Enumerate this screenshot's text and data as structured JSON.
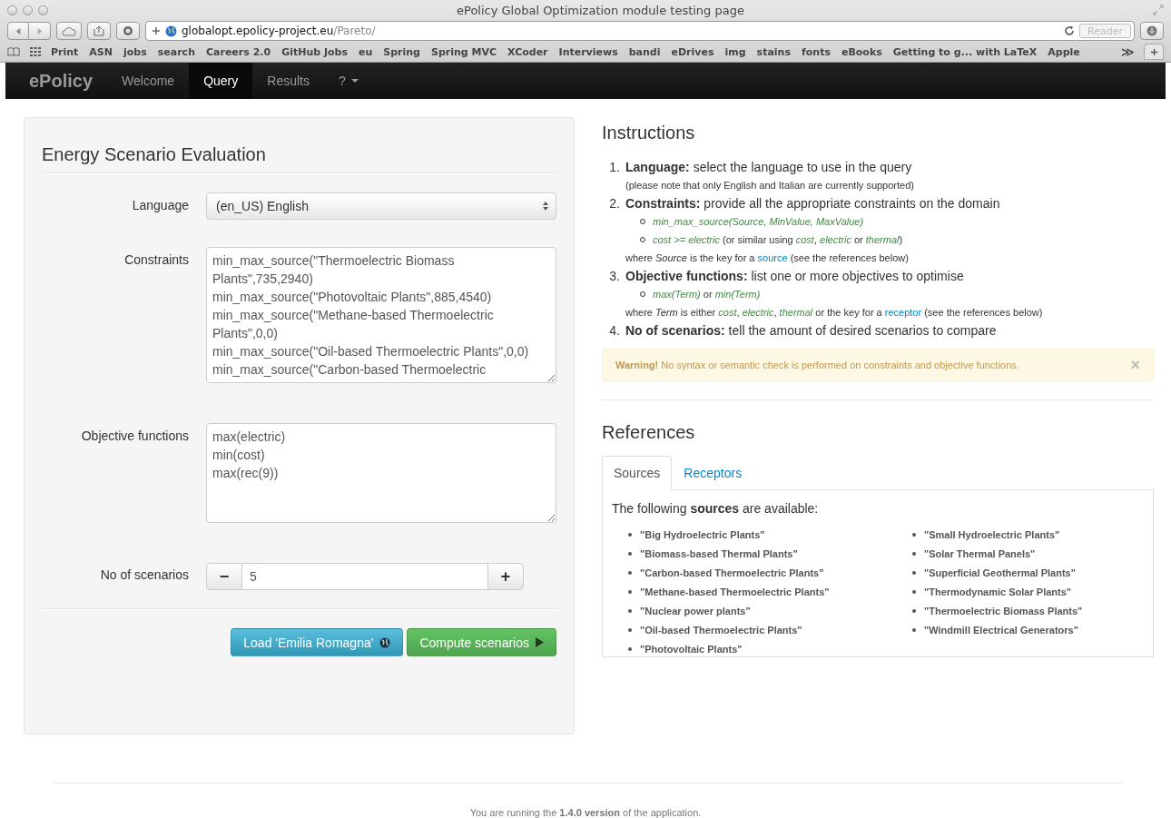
{
  "window": {
    "title": "ePolicy Global Optimization module testing page"
  },
  "toolbar": {
    "url_host": "globalopt.epolicy-project.eu",
    "url_path": "/Pareto/",
    "reader": "Reader"
  },
  "bookmarks": [
    "Print",
    "ASN",
    "jobs",
    "search",
    "Careers 2.0",
    "GitHub Jobs",
    "eu",
    "Spring",
    "Spring MVC",
    "XCoder",
    "Interviews",
    "bandi",
    "eDrives",
    "img",
    "stains",
    "fonts",
    "eBooks",
    "Getting to g... with LaTeX",
    "Apple"
  ],
  "bookmarks_more": "≫",
  "navbar": {
    "brand": "ePolicy",
    "items": [
      {
        "label": "Welcome",
        "selected": false,
        "dropdown": false
      },
      {
        "label": "Query",
        "selected": true,
        "dropdown": false
      },
      {
        "label": "Results",
        "selected": false,
        "dropdown": false
      },
      {
        "label": "?",
        "selected": false,
        "dropdown": true
      }
    ]
  },
  "form": {
    "title": "Energy Scenario Evaluation",
    "language": {
      "label": "Language",
      "value": "(en_US) English"
    },
    "constraints": {
      "label": "Constraints",
      "value": "min_max_source(\"Thermoelectric Biomass Plants\",735,2940)\nmin_max_source(\"Photovoltaic Plants\",885,4540)\nmin_max_source(\"Methane-based Thermoelectric Plants\",0,0)\nmin_max_source(\"Oil-based Thermoelectric Plants\",0,0)\nmin_max_source(\"Carbon-based Thermoelectric"
    },
    "objectives": {
      "label": "Objective functions",
      "value": "max(electric)\nmin(cost)\nmax(rec(9))"
    },
    "scenarios": {
      "label": "No of scenarios",
      "value": "5",
      "minus": "−",
      "plus": "+"
    },
    "buttons": [
      {
        "label": "Load 'Emilia Romagna'",
        "kind": "info"
      },
      {
        "label": "Compute scenarios",
        "kind": "success"
      }
    ]
  },
  "instructions": {
    "title": "Instructions",
    "items": [
      {
        "number": "1.",
        "heading": "Language:",
        "text": "select the language to use in the query",
        "notes": [
          [
            {
              "kind": "plain",
              "text": "(please note that only English and Italian are currently supported)"
            }
          ]
        ]
      },
      {
        "number": "2.",
        "heading": "Constraints:",
        "text": "provide all the appropriate constraints on the domain",
        "subitems": [
          [
            {
              "kind": "code",
              "text": "min_max_source(Source, MinValue, MaxValue)"
            }
          ],
          [
            {
              "kind": "code",
              "text": "cost >= electric"
            },
            {
              "kind": "plain",
              "text": " (or similar using "
            },
            {
              "kind": "code",
              "text": "cost"
            },
            {
              "kind": "plain",
              "text": ", "
            },
            {
              "kind": "code",
              "text": "electric"
            },
            {
              "kind": "plain",
              "text": " or "
            },
            {
              "kind": "code",
              "text": "thermal"
            },
            {
              "kind": "plain",
              "text": ")"
            }
          ]
        ],
        "notes": [
          [
            {
              "kind": "plain",
              "text": "where "
            },
            {
              "kind": "em",
              "text": "Source"
            },
            {
              "kind": "plain",
              "text": " is the key for a "
            },
            {
              "kind": "link",
              "text": "source"
            },
            {
              "kind": "plain",
              "text": " (see the references below)"
            }
          ]
        ]
      },
      {
        "number": "3.",
        "heading": "Objective functions:",
        "text": "list one or more objectives to optimise",
        "subitems": [
          [
            {
              "kind": "code",
              "text": "max(Term)"
            },
            {
              "kind": "plain",
              "text": " or "
            },
            {
              "kind": "code",
              "text": "min(Term)"
            }
          ]
        ],
        "notes": [
          [
            {
              "kind": "plain",
              "text": "where "
            },
            {
              "kind": "em",
              "text": "Term"
            },
            {
              "kind": "plain",
              "text": " is either "
            },
            {
              "kind": "code",
              "text": "cost"
            },
            {
              "kind": "plain",
              "text": ", "
            },
            {
              "kind": "code",
              "text": "electric"
            },
            {
              "kind": "plain",
              "text": ", "
            },
            {
              "kind": "code",
              "text": "thermal"
            },
            {
              "kind": "plain",
              "text": " or the key for a "
            },
            {
              "kind": "link",
              "text": "receptor"
            },
            {
              "kind": "plain",
              "text": " (see the references below)"
            }
          ]
        ]
      },
      {
        "number": "4.",
        "heading": "No of scenarios:",
        "text": "tell the amount of desired scenarios to compare"
      }
    ],
    "warning": {
      "text": "**Warning!** No syntax or semantic check is performed on constraints and objective functions.",
      "close": "×"
    }
  },
  "references": {
    "title": "References",
    "tabs": [
      {
        "label": "Sources",
        "selected": true
      },
      {
        "label": "Receptors",
        "selected": false
      }
    ],
    "intro": "The following **sources** are available:",
    "sources": [
      "\"Big Hydroelectric Plants\"",
      "\"Biomass-based Thermal Plants\"",
      "\"Carbon-based Thermoelectric Plants\"",
      "\"Methane-based Thermoelectric Plants\"",
      "\"Nuclear power plants\"",
      "\"Oil-based Thermoelectric Plants\"",
      "\"Photovoltaic Plants\"",
      "\"Small Hydroelectric Plants\"",
      "\"Solar Thermal Panels\"",
      "\"Superficial Geothermal Plants\"",
      "\"Thermodynamic Solar Plants\"",
      "\"Thermoelectric Biomass Plants\"",
      "\"Windmill Electrical Generators\""
    ]
  },
  "footer": "You are running the **1.4.0 version** of the application."
}
